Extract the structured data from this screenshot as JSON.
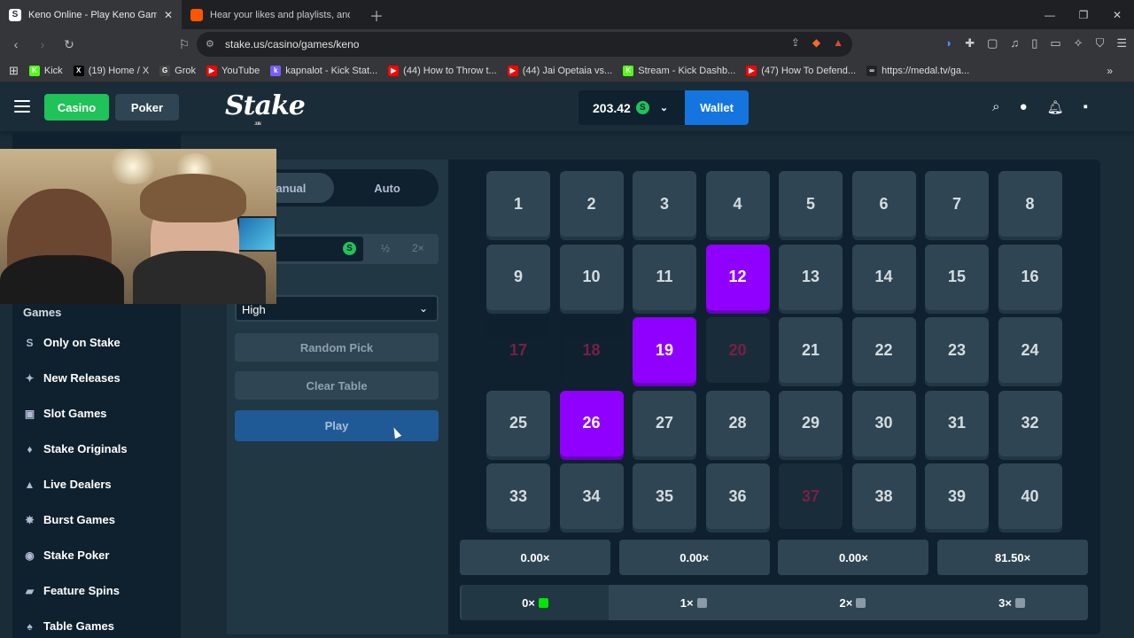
{
  "browser": {
    "tabs": [
      {
        "title": "Keno Online - Play Keno Gam",
        "icon": "stake-favicon",
        "icon_letter": "S",
        "active": true
      },
      {
        "title": "Hear your likes and playlists, and trac",
        "icon": "soundcloud-favicon",
        "icon_letter": "",
        "active": false
      }
    ],
    "url": "stake.us/casino/games/keno",
    "bookmarks": [
      {
        "label": "Kick",
        "icon_letter": "K",
        "color": "#53fc18"
      },
      {
        "label": "(19) Home / X",
        "icon_letter": "X",
        "color": "#000000"
      },
      {
        "label": "Grok",
        "icon_letter": "G",
        "color": "#444444"
      },
      {
        "label": "YouTube",
        "icon_letter": "▶",
        "color": "#ff0000"
      },
      {
        "label": "kapnalot - Kick Stat...",
        "icon_letter": "k",
        "color": "#7b5cff"
      },
      {
        "label": "(44) How to Throw t...",
        "icon_letter": "▶",
        "color": "#ff0000"
      },
      {
        "label": "(44) Jai Opetaia vs...",
        "icon_letter": "▶",
        "color": "#ff0000"
      },
      {
        "label": "Stream - Kick Dashb...",
        "icon_letter": "K",
        "color": "#53fc18"
      },
      {
        "label": "(47) How To Defend...",
        "icon_letter": "▶",
        "color": "#ff0000"
      },
      {
        "label": "https://medal.tv/ga...",
        "icon_letter": "∞",
        "color": "#222222"
      }
    ]
  },
  "header": {
    "casino_label": "Casino",
    "poker_label": "Poker",
    "logo_text": "Stake",
    "logo_sub": ".us",
    "balance": "203.42",
    "currency_symbol": "S",
    "wallet_label": "Wallet"
  },
  "sidebar": {
    "section_title": "Games",
    "items": [
      {
        "label": "Only on Stake",
        "icon": "stake-icon",
        "glyph": "S"
      },
      {
        "label": "New Releases",
        "icon": "sparkle-icon",
        "glyph": "✦"
      },
      {
        "label": "Slot Games",
        "icon": "slots-icon",
        "glyph": "▣"
      },
      {
        "label": "Stake Originals",
        "icon": "flame-icon",
        "glyph": "♦"
      },
      {
        "label": "Live Dealers",
        "icon": "dealer-icon",
        "glyph": "▲"
      },
      {
        "label": "Burst Games",
        "icon": "burst-icon",
        "glyph": "✸"
      },
      {
        "label": "Stake Poker",
        "icon": "poker-chip-icon",
        "glyph": "◉"
      },
      {
        "label": "Feature Spins",
        "icon": "spins-icon",
        "glyph": "▰"
      },
      {
        "label": "Table Games",
        "icon": "table-icon",
        "glyph": "♠"
      }
    ]
  },
  "controls": {
    "manual_label": "Manual",
    "auto_label": "Auto",
    "half_label": "½",
    "double_label": "2×",
    "risk_value": "High",
    "random_pick_label": "Random Pick",
    "clear_table_label": "Clear Table",
    "play_label": "Play"
  },
  "board": {
    "tiles": [
      "1",
      "2",
      "3",
      "4",
      "5",
      "6",
      "7",
      "8",
      "9",
      "10",
      "11",
      "12",
      "13",
      "14",
      "15",
      "16",
      "17",
      "18",
      "19",
      "20",
      "21",
      "22",
      "23",
      "24",
      "25",
      "26",
      "27",
      "28",
      "29",
      "30",
      "31",
      "32",
      "33",
      "34",
      "35",
      "36",
      "37",
      "38",
      "39",
      "40"
    ],
    "selected": [
      "12",
      "19",
      "26"
    ],
    "drawn_misses": [
      "17",
      "18",
      "20",
      "37"
    ],
    "payouts": [
      "0.00×",
      "0.00×",
      "0.00×",
      "81.50×"
    ],
    "hits": [
      {
        "label": "0×",
        "gem_color": "#00e701"
      },
      {
        "label": "1×",
        "gem_color": "#8a9aa6"
      },
      {
        "label": "2×",
        "gem_color": "#8a9aa6"
      },
      {
        "label": "3×",
        "gem_color": "#8a9aa6"
      }
    ]
  },
  "colors": {
    "accent_green": "#1fc35a",
    "wallet_blue": "#1475e1",
    "selected_purple": "#9000ff",
    "miss_red": "#ce1f5b"
  }
}
